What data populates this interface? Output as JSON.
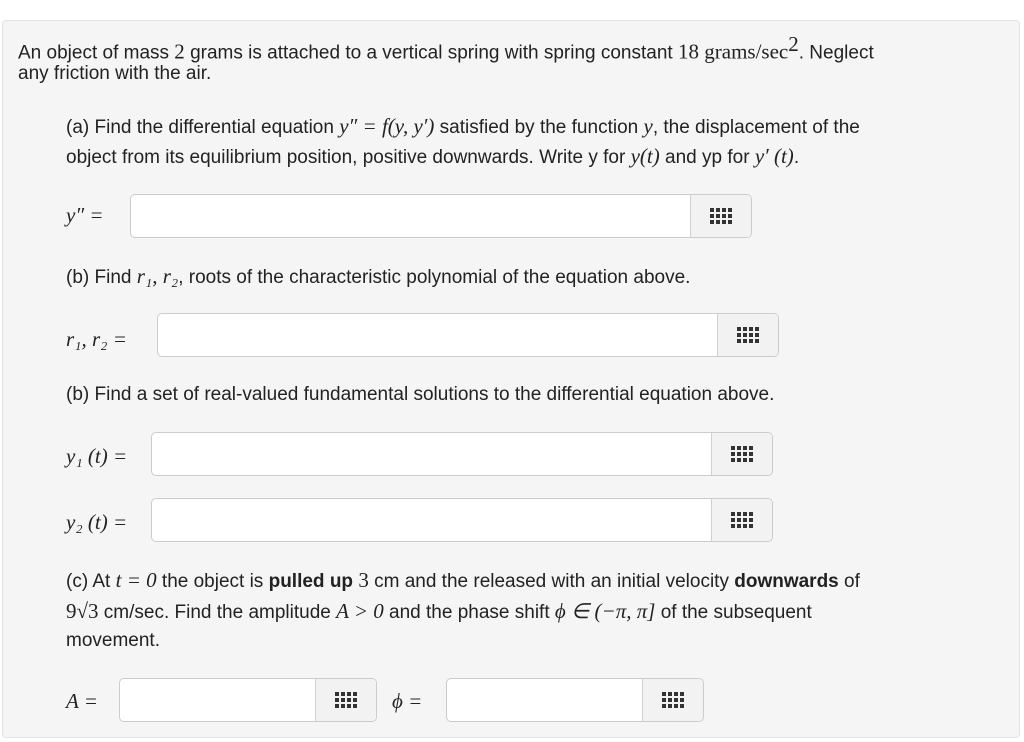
{
  "intro": {
    "line1_a": "An object of mass ",
    "mass": "2",
    "line1_b": " grams is attached to a vertical spring with spring constant ",
    "k": "18",
    "units": "grams/sec",
    "units_exp": "2",
    "line1_c": ". Neglect",
    "line2": "any friction with the air."
  },
  "part_a": {
    "t1": "(a) Find the differential equation ",
    "eq": "y″ = f(y, y′)",
    "t2": " satisfied by the function ",
    "y": "y",
    "t3": ", the displacement of the",
    "line2_a": "object from its equilibrium position, positive downwards. Write y for ",
    "yt": "y(t)",
    "line2_b": " and yp for ",
    "ypt": "y′ (t)",
    "line2_c": ".",
    "label": "y″  ="
  },
  "part_b1": {
    "t1": "(b) Find ",
    "roots": "r₁, r₂",
    "t2": ", roots of the characteristic polynomial of the equation above.",
    "label": "r₁, r₂ ="
  },
  "part_b2": {
    "text": "(b) Find a set of real-valued fundamental solutions to the differential equation above.",
    "label1": "y₁ (t) =",
    "label2": "y₂ (t) ="
  },
  "part_c": {
    "a1": "(c) At ",
    "tvar": "t = 0",
    "a2": " the object is ",
    "pulled": "pulled up",
    "a3": " ",
    "dist": "3",
    "a4": " cm and the released with an initial velocity ",
    "down": "downwards",
    "a5": " of",
    "b1": "9√3",
    "b2": " cm/sec. Find the amplitude ",
    "amp": "A > 0",
    "b3": " and the phase shift ",
    "phi": "ϕ ∈ (−π, π]",
    "b4": " of the subsequent",
    "c1": "movement.",
    "label_A": "A =",
    "label_phi": "ϕ ="
  },
  "icons": {
    "palette": "equation-palette-icon"
  }
}
